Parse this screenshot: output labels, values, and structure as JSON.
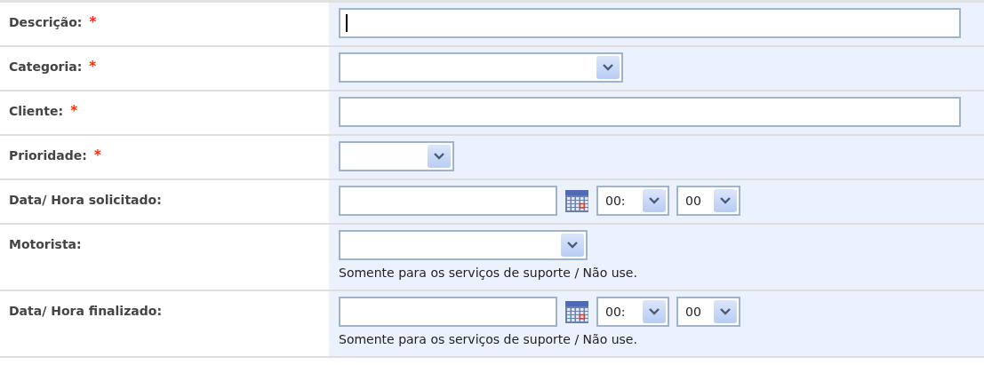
{
  "fields": [
    {
      "label": "Descrição:",
      "required_mark": "*",
      "kind": "text",
      "focused": true
    },
    {
      "label": "Categoria:",
      "required_mark": "*",
      "kind": "select"
    },
    {
      "label": "Cliente:",
      "required_mark": "*",
      "kind": "text"
    },
    {
      "label": "Prioridade:",
      "required_mark": "*",
      "kind": "select"
    },
    {
      "label": "Data/ Hora solicitado:",
      "kind": "datetime",
      "hour": "00:",
      "minute": "00"
    },
    {
      "label": "Motorista:",
      "kind": "select",
      "hint": "Somente para os serviços de suporte / Não use."
    },
    {
      "label": "Data/ Hora finalizado:",
      "kind": "datetime",
      "hour": "00:",
      "minute": "00",
      "hint": "Somente para os serviços de suporte / Não use."
    }
  ]
}
